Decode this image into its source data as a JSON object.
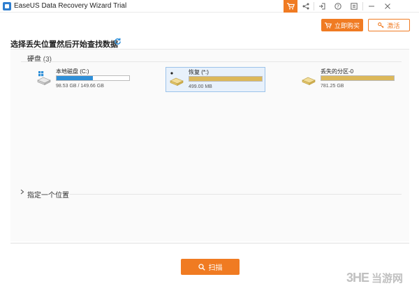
{
  "app": {
    "title": "EaseUS Data Recovery Wizard Trial",
    "icon": "easeus-logo-icon"
  },
  "titlebar": {
    "buttons": [
      {
        "name": "cart",
        "glyph": "🛒"
      },
      {
        "name": "share",
        "glyph": "⋖"
      },
      {
        "name": "login",
        "glyph": "⇥"
      },
      {
        "name": "help",
        "glyph": "?"
      },
      {
        "name": "menu",
        "glyph": "≡"
      },
      {
        "name": "minimize",
        "glyph": "—"
      },
      {
        "name": "close",
        "glyph": "✕"
      }
    ]
  },
  "top_actions": {
    "buy_label": "立即购买",
    "activate_label": "激活"
  },
  "heading": "选择丢失位置然后开始查找数据",
  "hdd_section": {
    "label": "硬盘",
    "count": "(3)"
  },
  "drives": [
    {
      "name": "本地磁盘 (C:)",
      "size": "98.53 GB / 149.66 GB",
      "fill": 0.5,
      "fill_color": "#2f8fd8",
      "os_icon": "windows-icon"
    },
    {
      "name": "恢复 (*:)",
      "size": "499.00 MB",
      "fill": 1.0,
      "fill_color": "#dcb85a",
      "os_icon": "none"
    },
    {
      "name": "丢失的分区-0",
      "size": "781.25 GB",
      "fill": 1.0,
      "fill_color": "#dcb85a",
      "os_icon": "none"
    }
  ],
  "location_section": {
    "label": "指定一个位置"
  },
  "scan_button": {
    "label": "扫描"
  },
  "watermark": {
    "logo": "3HE",
    "text": "当游网"
  },
  "colors": {
    "accent": "#f07b22",
    "blue": "#2f8fd8",
    "drive_gold": "#dcb85a"
  }
}
